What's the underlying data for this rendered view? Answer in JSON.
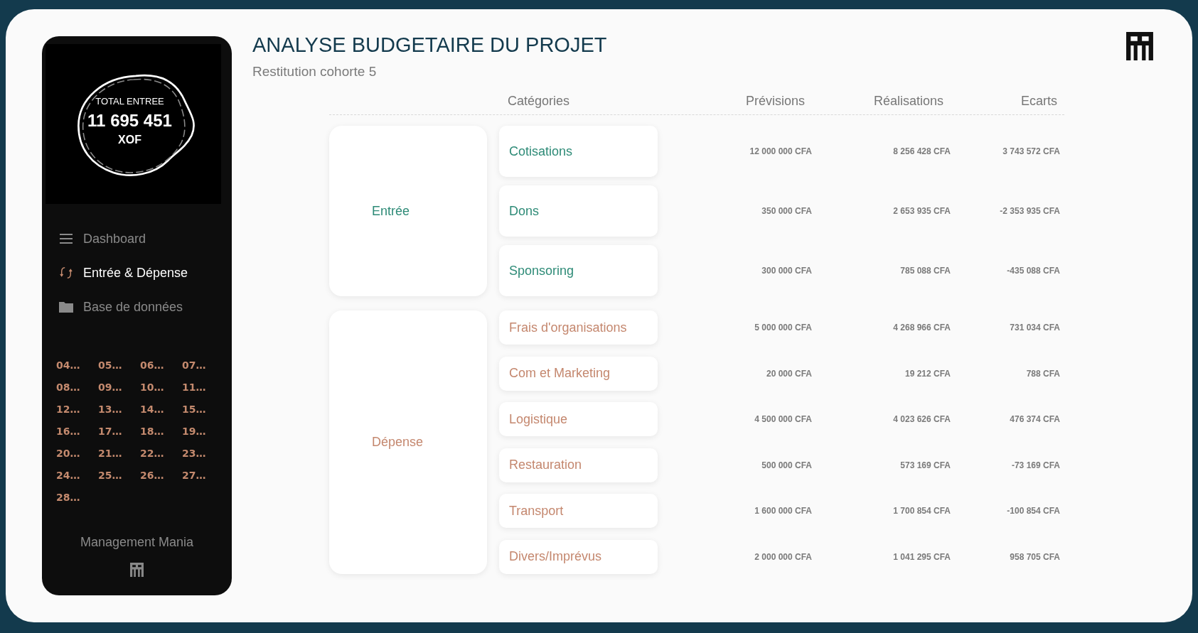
{
  "sidebar": {
    "kpi": {
      "label": "TOTAL ENTREE",
      "value": "11 695 451",
      "unit": "XOF"
    },
    "nav": [
      {
        "label": "Dashboard",
        "kind": "menu",
        "selected": false
      },
      {
        "label": "Entrée & Dépense",
        "kind": "swap",
        "selected": true
      },
      {
        "label": "Base de données",
        "kind": "folder",
        "selected": false
      }
    ],
    "dates": [
      "04…",
      "05…",
      "06…",
      "07…",
      "08…",
      "09…",
      "10…",
      "11…",
      "12…",
      "13…",
      "14…",
      "15…",
      "16…",
      "17…",
      "18…",
      "19…",
      "20…",
      "21…",
      "22…",
      "23…",
      "24…",
      "25…",
      "26…",
      "27…",
      "28…"
    ],
    "brand": "Management Mania"
  },
  "header": {
    "title": "ANALYSE BUDGETAIRE DU PROJET",
    "subtitle": "Restitution cohorte 5"
  },
  "table": {
    "columns": [
      "Catégories",
      "Prévisions",
      "Réalisations",
      "Ecarts"
    ],
    "groups": [
      {
        "label": "Entrée",
        "kind": "income",
        "rows": [
          {
            "category": "Cotisations",
            "forecast": "12 000 000 CFA",
            "actual": "8 256 428 CFA",
            "variance": "3 743 572 CFA"
          },
          {
            "category": "Dons",
            "forecast": "350 000 CFA",
            "actual": "2 653 935 CFA",
            "variance": "-2 353 935 CFA"
          },
          {
            "category": "Sponsoring",
            "forecast": "300 000 CFA",
            "actual": "785 088 CFA",
            "variance": "-435 088 CFA"
          }
        ]
      },
      {
        "label": "Dépense",
        "kind": "expense",
        "rows": [
          {
            "category": "Frais d'organisations",
            "forecast": "5 000 000 CFA",
            "actual": "4 268 966 CFA",
            "variance": "731 034 CFA"
          },
          {
            "category": "Com et Marketing",
            "forecast": "20 000 CFA",
            "actual": "19 212 CFA",
            "variance": "788 CFA"
          },
          {
            "category": "Logistique",
            "forecast": "4 500 000 CFA",
            "actual": "4 023 626 CFA",
            "variance": "476 374 CFA"
          },
          {
            "category": "Restauration",
            "forecast": "500 000 CFA",
            "actual": "573 169 CFA",
            "variance": "-73 169 CFA"
          },
          {
            "category": "Transport",
            "forecast": "1 600 000 CFA",
            "actual": "1 700 854 CFA",
            "variance": "-100 854 CFA"
          },
          {
            "category": "Divers/Imprévus",
            "forecast": "2 000 000 CFA",
            "actual": "1 041 295 CFA",
            "variance": "958 705 CFA"
          }
        ]
      }
    ]
  }
}
